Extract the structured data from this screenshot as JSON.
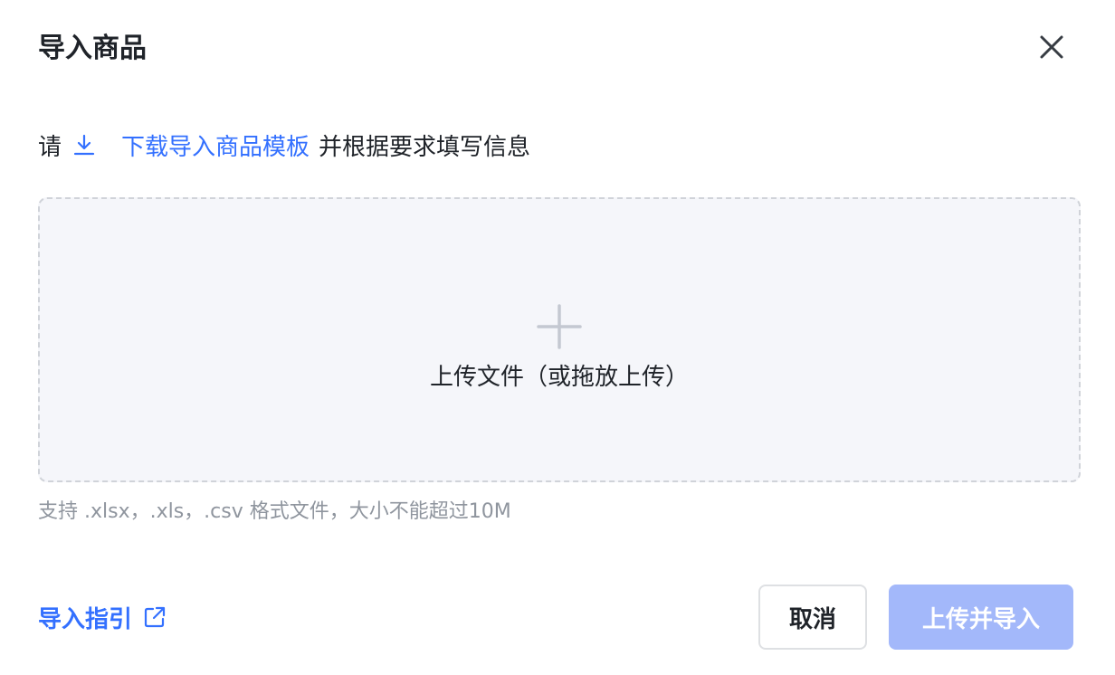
{
  "dialog": {
    "title": "导入商品",
    "close_icon": "close-icon"
  },
  "instruction": {
    "prefix": "请",
    "download_icon": "download-icon",
    "link_text": "下载导入商品模板",
    "suffix": "并根据要求填写信息"
  },
  "dropzone": {
    "icon": "plus-icon",
    "label": "上传文件（或拖放上传）"
  },
  "hint": "支持 .xlsx，.xls，.csv 格式文件，大小不能超过10M",
  "footer": {
    "guide_label": "导入指引",
    "guide_icon": "external-link-icon",
    "cancel_label": "取消",
    "submit_label": "上传并导入"
  },
  "colors": {
    "accent": "#3370ff",
    "submit_disabled": "#a3b8fa",
    "dropzone_bg": "#f5f6fa",
    "hint_text": "#8f959e"
  }
}
